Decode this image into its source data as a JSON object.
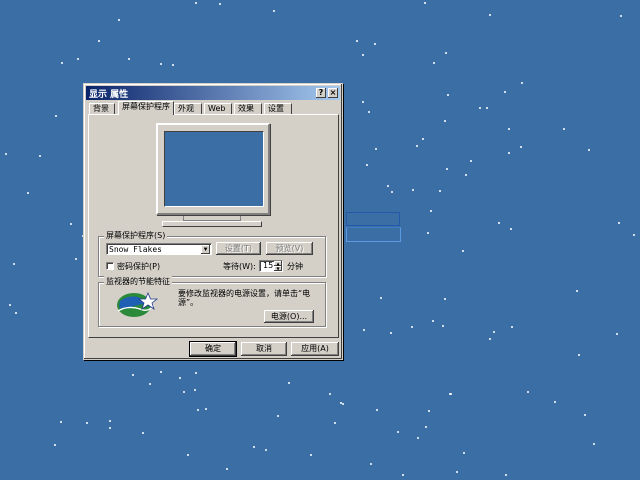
{
  "dialog": {
    "title": "显示 属性",
    "help_label": "?",
    "close_label": "×"
  },
  "tabs": [
    {
      "label": "背景"
    },
    {
      "label": "屏幕保护程序"
    },
    {
      "label": "外观"
    },
    {
      "label": "Web"
    },
    {
      "label": "效果"
    },
    {
      "label": "设置"
    }
  ],
  "active_tab": "屏幕保护程序",
  "screensaver": {
    "group_label": "屏幕保护程序(S)",
    "selected": "Snow Flakes",
    "settings_label": "设置(T)",
    "preview_label": "预览(V)",
    "password_label": "密码保护(P)",
    "password_checked": false,
    "wait_label": "等待(W):",
    "wait_value": "15",
    "minutes_label": "分钟"
  },
  "energy": {
    "group_label": "监视器的节能特征",
    "description": "要修改监视器的电源设置，请单击“电源”。",
    "power_label": "电源(O)..."
  },
  "buttons": {
    "ok": "确定",
    "cancel": "取消",
    "apply": "应用(A)"
  },
  "colors": {
    "desktop": "#3a6ea5",
    "dialog_face": "#d4d0c8",
    "title_start": "#0a246a",
    "title_end": "#a6caf0"
  }
}
